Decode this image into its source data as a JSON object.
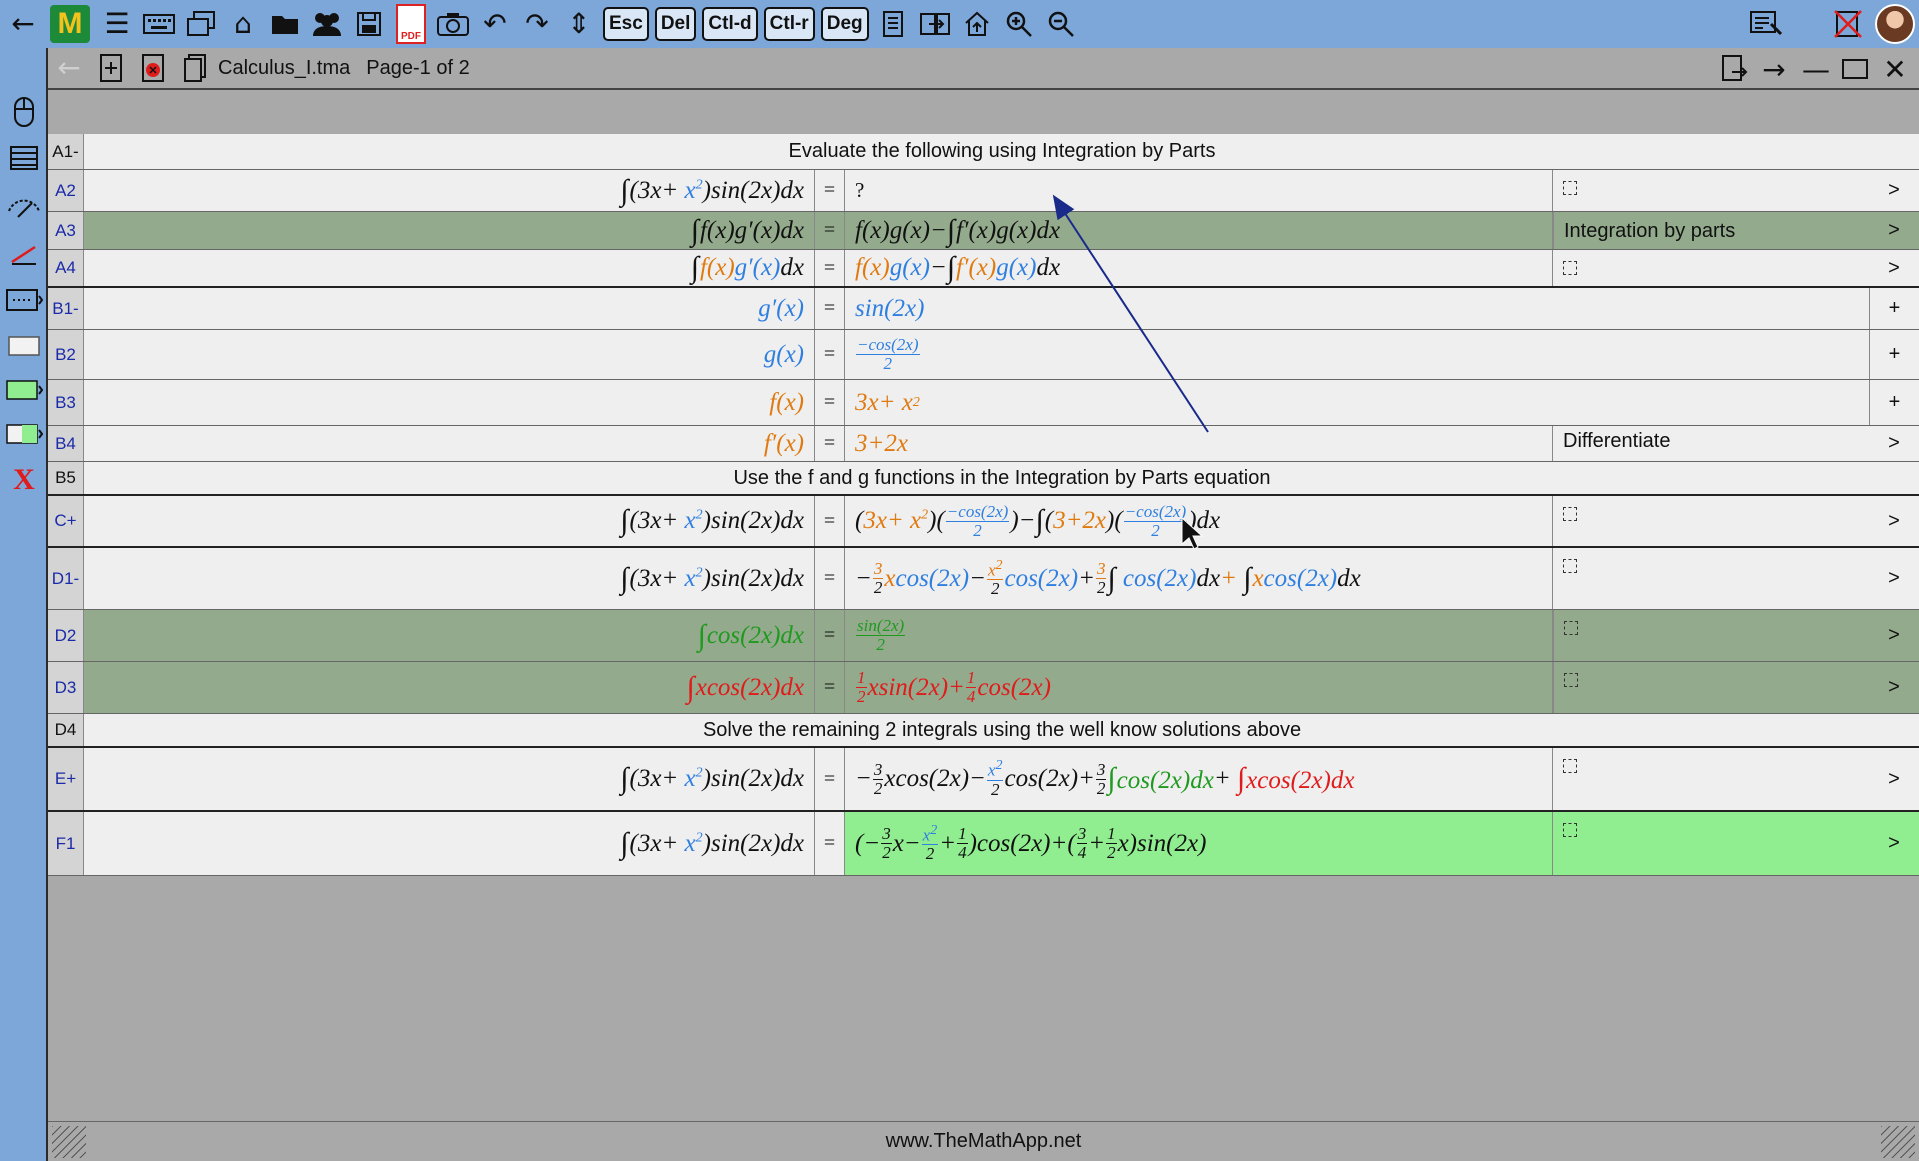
{
  "toolbar": {
    "logo": "M",
    "keys": [
      "Esc",
      "Del",
      "Ctl-d",
      "Ctl-r",
      "Deg"
    ],
    "pdf_label": "PDF",
    "icons": [
      "back-arrow-icon",
      "menu-icon",
      "keyboard-icon",
      "windows-icon",
      "home-icon",
      "folder-icon",
      "users-icon",
      "save-icon",
      "pdf-icon",
      "camera-icon",
      "undo-icon",
      "redo-icon",
      "vertical-resize-icon",
      "document-icon",
      "export-icon",
      "upload-icon",
      "zoom-in-icon",
      "zoom-out-icon",
      "presentation-icon",
      "close-document-icon",
      "avatar"
    ]
  },
  "sidebar": {
    "tools": [
      "mouse-icon",
      "list-icon",
      "eraser-icon",
      "line-tool-icon",
      "dotted-box-icon",
      "white-box-icon",
      "green-box-icon",
      "half-green-box-icon",
      "red-x-icon"
    ]
  },
  "document": {
    "filename": "Calculus_I.tma",
    "page": "Page-1 of 2"
  },
  "rows": {
    "A1": {
      "label": "A1-",
      "banner": "Evaluate the following using Integration by Parts"
    },
    "A2": {
      "label": "A2",
      "eq": "=",
      "rhs": "?",
      "act": ">"
    },
    "A3": {
      "label": "A3",
      "eq": "=",
      "note": "Integration by parts",
      "act": ">"
    },
    "A4": {
      "label": "A4",
      "eq": "=",
      "act": ">"
    },
    "B1": {
      "label": "B1-",
      "eq": "=",
      "act": "+"
    },
    "B2": {
      "label": "B2",
      "eq": "=",
      "act": "+"
    },
    "B3": {
      "label": "B3",
      "eq": "=",
      "act": "+"
    },
    "B4": {
      "label": "B4",
      "eq": "=",
      "note": "Differentiate",
      "act": ">"
    },
    "B5": {
      "label": "B5",
      "banner": "Use the f and g functions in the Integration by Parts equation"
    },
    "C": {
      "label": "C+",
      "eq": "=",
      "act": ">"
    },
    "D1": {
      "label": "D1-",
      "eq": "=",
      "act": ">"
    },
    "D2": {
      "label": "D2",
      "eq": "=",
      "act": ">"
    },
    "D3": {
      "label": "D3",
      "eq": "=",
      "act": ">"
    },
    "D4": {
      "label": "D4",
      "banner": "Solve the remaining 2 integrals using the well know solutions above"
    },
    "E": {
      "label": "E+",
      "eq": "=",
      "act": ">"
    },
    "F1": {
      "label": "F1",
      "eq": "=",
      "act": ">"
    }
  },
  "footer": {
    "url": "www.TheMathApp.net"
  },
  "colors": {
    "toolbar": "#7da7d9",
    "canvas": "#a9a9a9",
    "row_light": "#efefef",
    "row_green": "#93aa8c",
    "row_lime": "#90ee90",
    "orange": "#e07a10",
    "blue": "#2f7fe0",
    "green": "#1f9a1f",
    "red": "#e01b1b"
  }
}
